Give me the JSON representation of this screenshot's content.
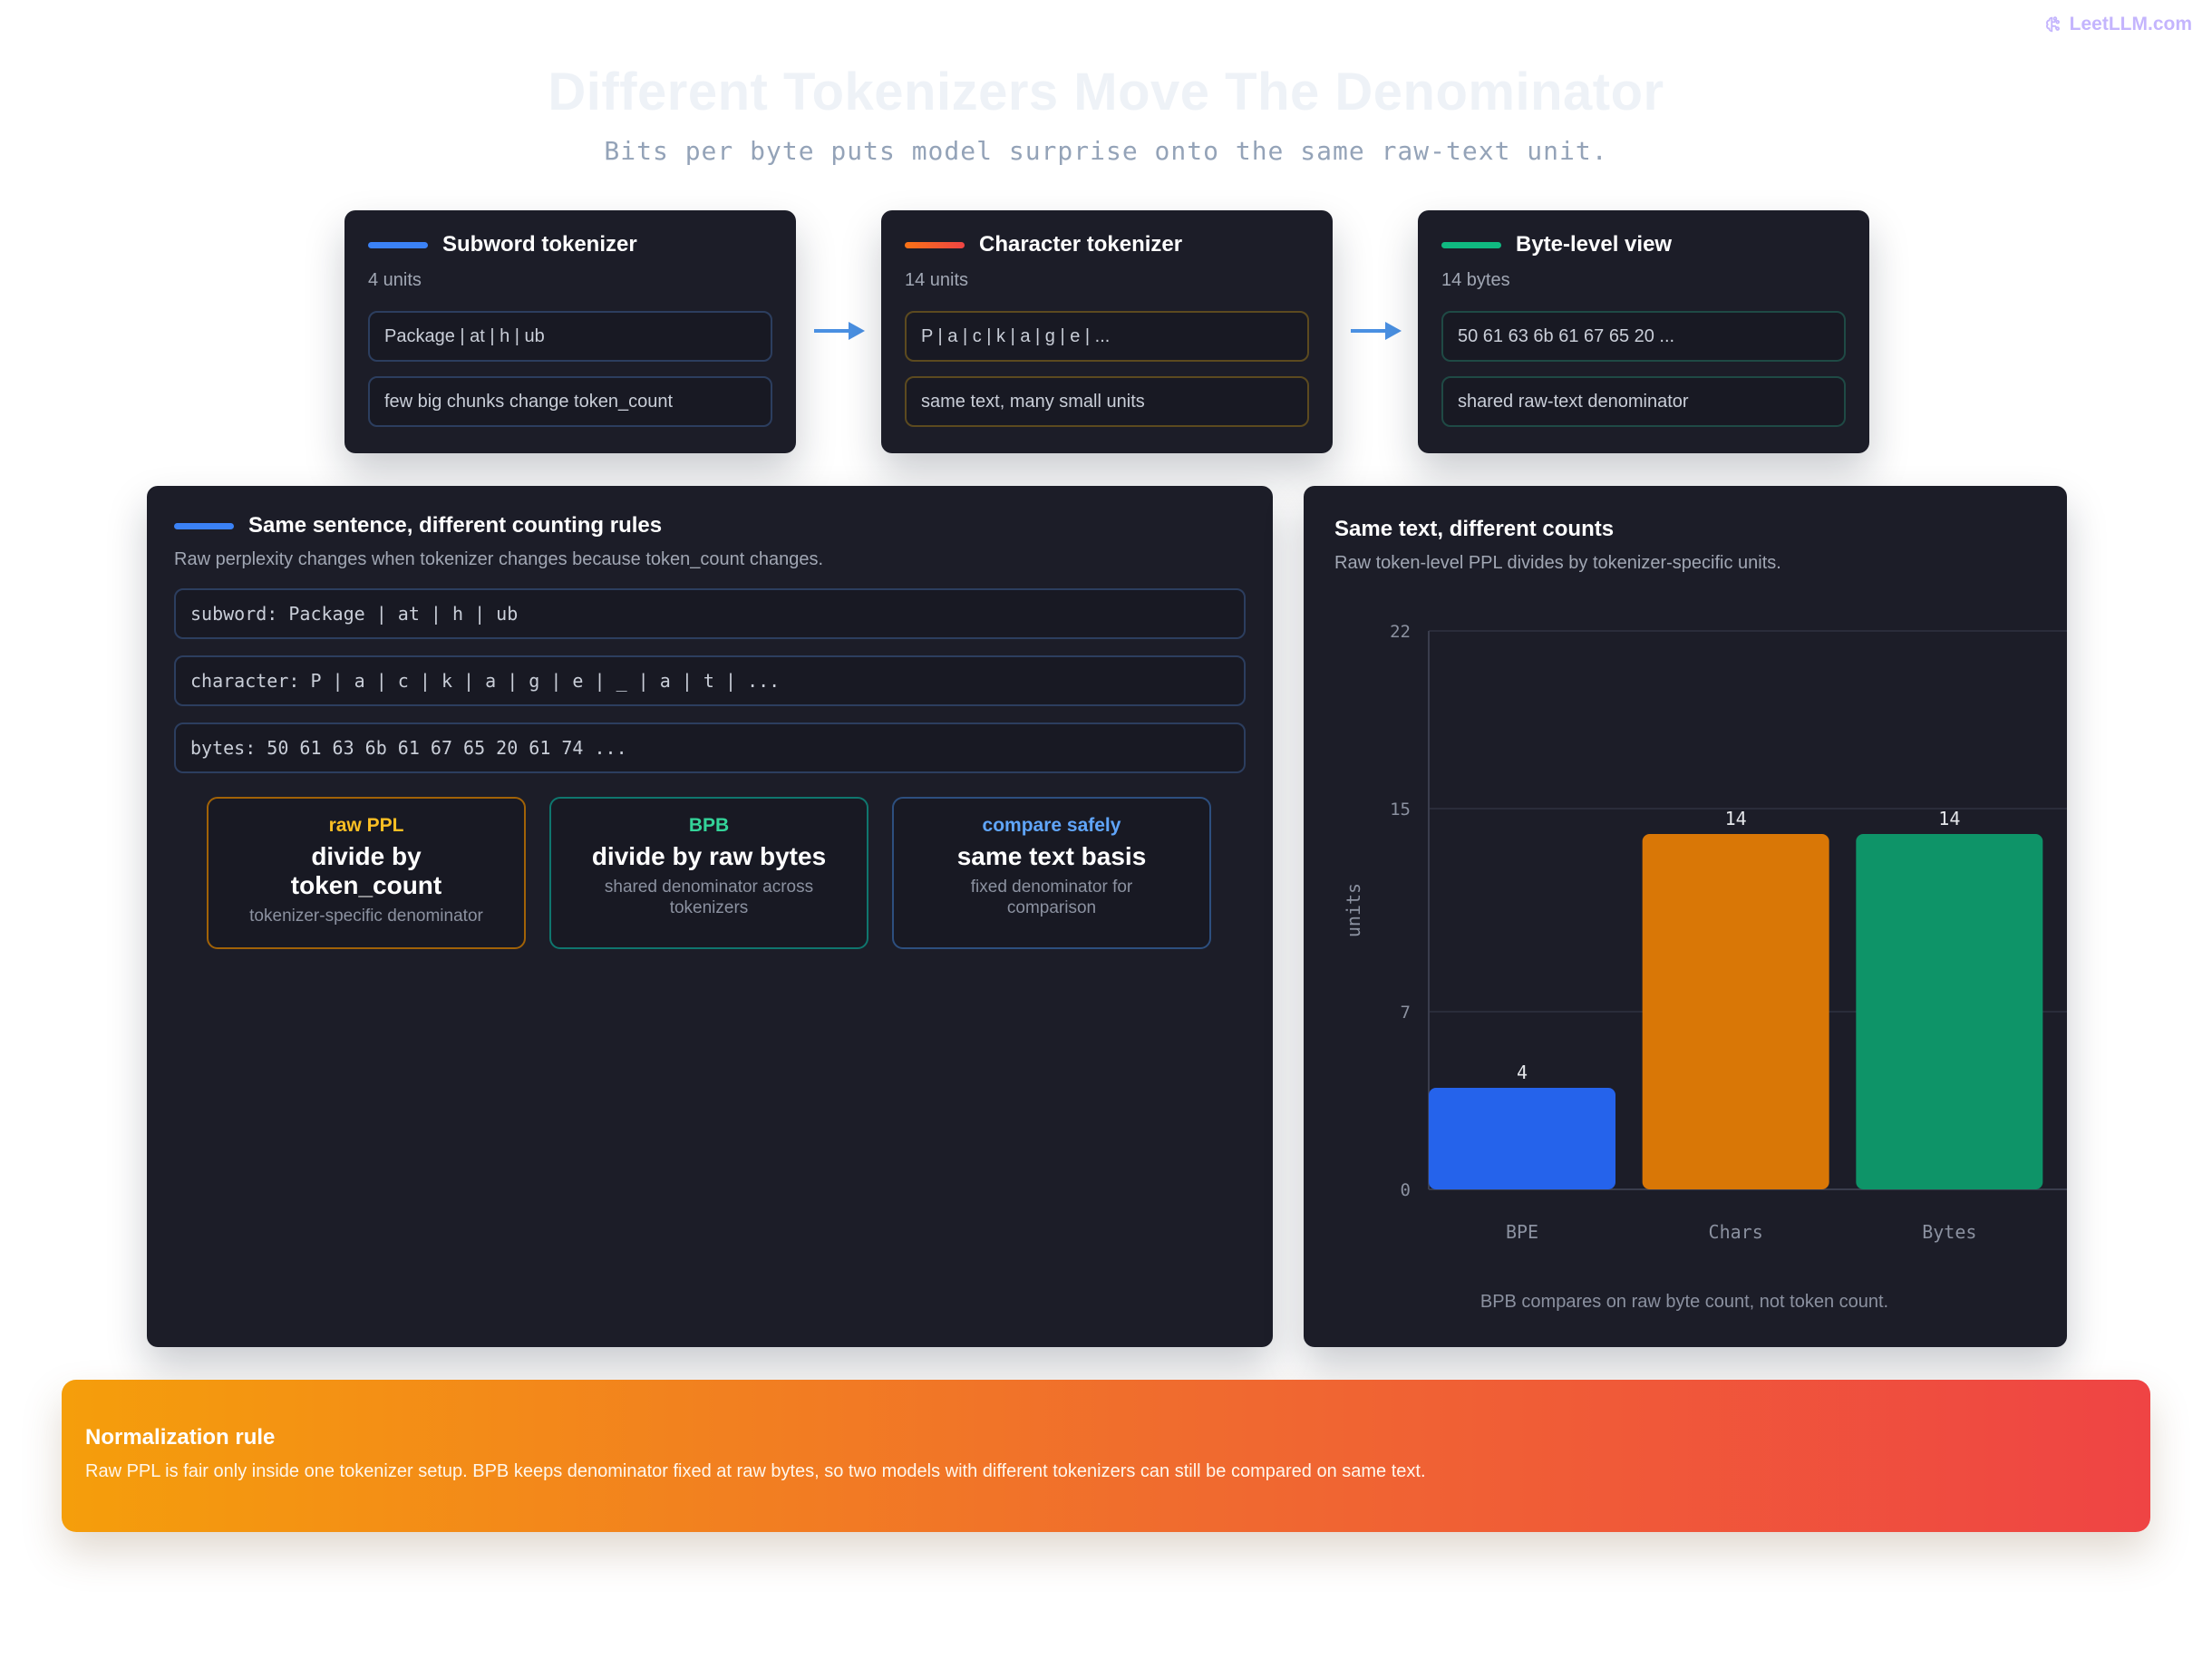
{
  "brand": {
    "label": "LeetLLM.com",
    "icon": "brain-icon"
  },
  "header": {
    "title": "Different Tokenizers Move The Denominator",
    "subtitle": "Bits per byte puts model surprise onto the same raw-text unit."
  },
  "tokenizers": [
    {
      "title": "Subword tokenizer",
      "count": "4 units",
      "box1": "Package | at | h | ub",
      "box2": "few big chunks change token_count",
      "accent": "#3b82f6",
      "border": "#2c3e5f"
    },
    {
      "title": "Character tokenizer",
      "count": "14 units",
      "box1": "P | a | c | k | a | g | e | ...",
      "box2": "same text, many small units",
      "accent": "#f97316",
      "border": "#5c4a1f"
    },
    {
      "title": "Byte-level view",
      "count": "14 bytes",
      "box1": "50 61 63 6b 61 67 65 20 ...",
      "box2": "shared raw-text denominator",
      "accent": "#10b981",
      "border": "#1f4a45"
    }
  ],
  "arrow_color": "#4a90e2",
  "left_panel": {
    "title": "Same sentence, different counting rules",
    "desc": "Raw perplexity changes when tokenizer changes because token_count changes.",
    "rows": [
      "subword: Package | at | h | ub",
      "character: P | a | c | k | a | g | e | _ | a | t | ...",
      "bytes: 50 61 63 6b 61 67 65 20 61 74 ..."
    ],
    "rules": [
      {
        "tag": "raw PPL",
        "main": "divide by token_count",
        "sub": "tokenizer-specific denominator",
        "color": "#fbbf24",
        "border": "#a16207"
      },
      {
        "tag": "BPB",
        "main": "divide by raw bytes",
        "sub": "shared denominator across tokenizers",
        "color": "#34d399",
        "border": "#0f766e"
      },
      {
        "tag": "compare safely",
        "main": "same text basis",
        "sub": "fixed denominator for comparison",
        "color": "#60a5fa",
        "border": "#2d4f7f"
      }
    ]
  },
  "right_panel": {
    "title": "Same text, different counts",
    "desc": "Raw token-level PPL divides by tokenizer-specific units.",
    "caption": "BPB compares on raw byte count, not token count."
  },
  "chart_data": {
    "type": "bar",
    "categories": [
      "BPE",
      "Chars",
      "Bytes"
    ],
    "values": [
      4,
      14,
      14
    ],
    "colors": [
      "#2563eb",
      "#d97706",
      "#0e9468"
    ],
    "ylabel": "units",
    "yticks": [
      0,
      7,
      15,
      22
    ],
    "ylim": [
      0,
      22
    ],
    "grid": true
  },
  "banner": {
    "title": "Normalization rule",
    "text": "Raw PPL is fair only inside one tokenizer setup. BPB keeps denominator fixed at raw bytes, so two models with different tokenizers can still be compared on same text."
  }
}
